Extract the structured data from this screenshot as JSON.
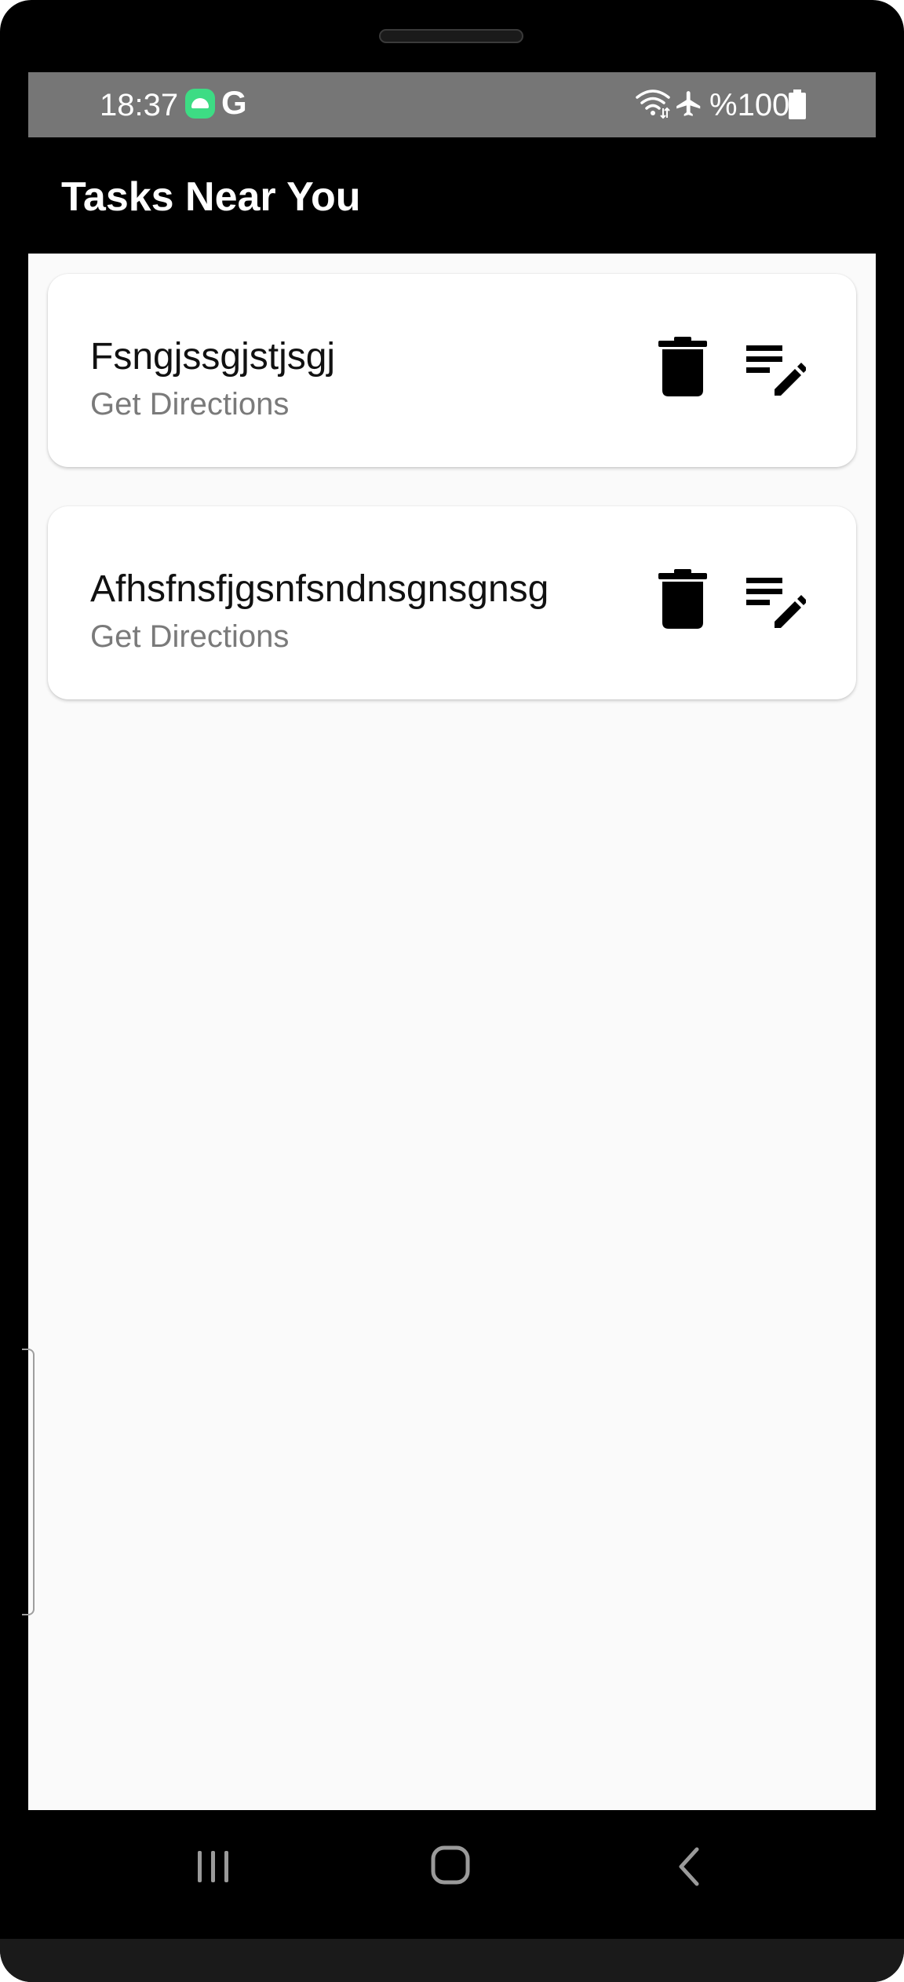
{
  "status_bar": {
    "time": "18:37",
    "google_letter": "G",
    "battery": "%100",
    "icons": [
      "android-notification-icon",
      "google-icon",
      "wifi-icon",
      "airplane-mode-icon",
      "battery-icon"
    ]
  },
  "app_bar": {
    "title": "Tasks Near You"
  },
  "tasks": [
    {
      "title": "Fsngjssgjstjsgj",
      "subtitle": "Get Directions",
      "icons": [
        "delete-icon",
        "edit-note-icon"
      ]
    },
    {
      "title": "Afhsfnsfjgsnfsndnsgnsgnsg",
      "subtitle": "Get Directions",
      "icons": [
        "delete-icon",
        "edit-note-icon"
      ]
    }
  ],
  "nav_bar": {
    "icons": [
      "recent-apps-icon",
      "home-icon",
      "back-icon"
    ]
  },
  "colors": {
    "status_bar_bg": "#767676",
    "app_bar_bg": "#000000",
    "content_bg": "#fafafa",
    "card_bg": "#ffffff",
    "subtitle_text": "#7a7a7a"
  }
}
